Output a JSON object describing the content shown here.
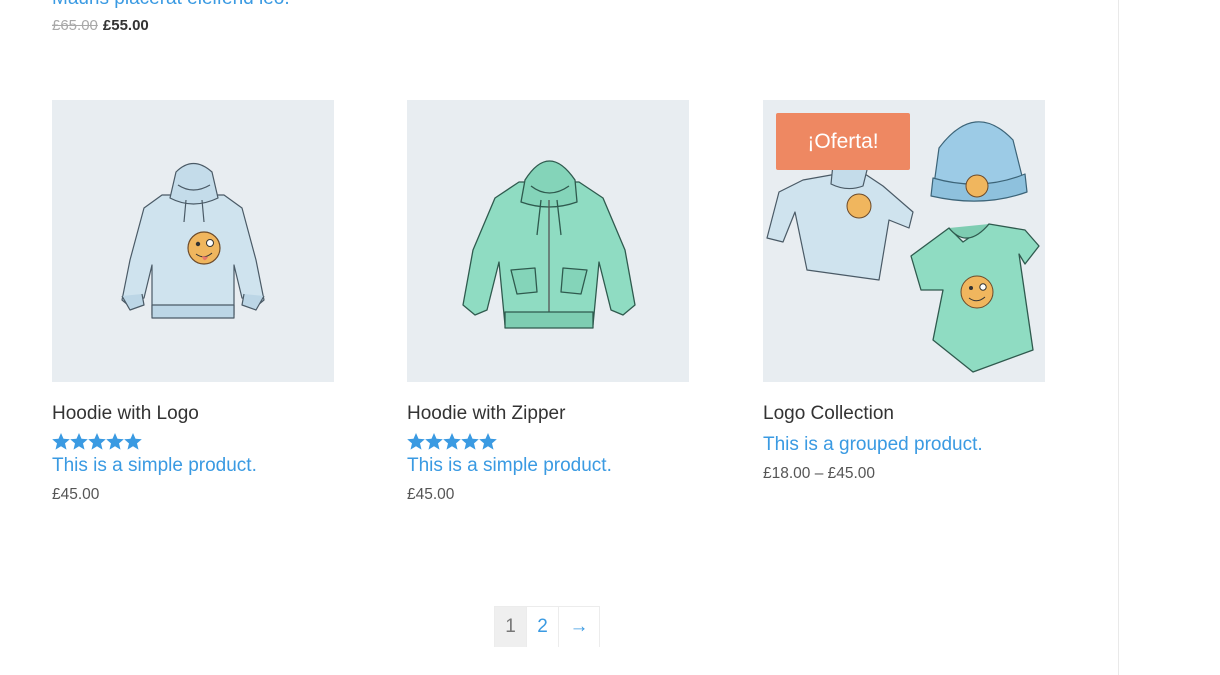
{
  "top_product": {
    "description": "Mauris placerat eleifend leo.",
    "old_price": "£65.00",
    "price": "£55.00"
  },
  "products": [
    {
      "title": "Hoodie with Logo",
      "rating": 5,
      "description": "This is a simple product.",
      "price": "£45.00",
      "image": "hoodie-with-logo-image"
    },
    {
      "title": "Hoodie with Zipper",
      "rating": 5,
      "description": "This is a simple product.",
      "price": "£45.00",
      "image": "hoodie-with-zipper-image"
    },
    {
      "title": "Logo Collection",
      "badge": "¡Oferta!",
      "description": "This is a grouped product.",
      "price": "£18.00 – £45.00",
      "image": "logo-collection-image"
    }
  ],
  "pagination": {
    "current": "1",
    "pages": [
      "2"
    ],
    "next": "→"
  },
  "colors": {
    "link": "#3a9ae2",
    "star": "#3a9ae2",
    "sale_badge": "#ee8862",
    "image_bg": "#e8edf1"
  }
}
